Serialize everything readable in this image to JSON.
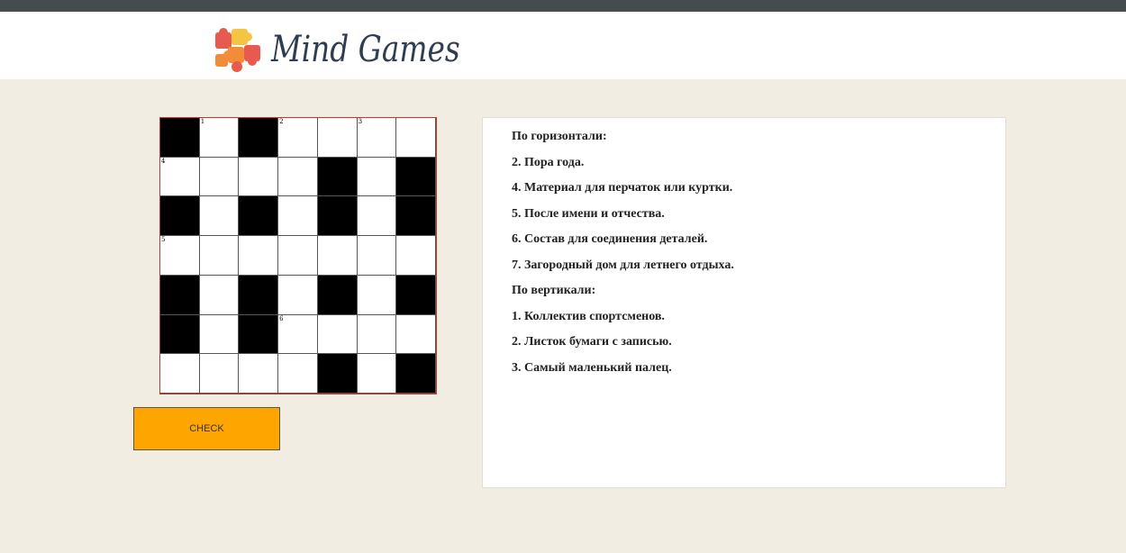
{
  "header": {
    "logo_text": "Mind Games"
  },
  "crossword": {
    "rows": [
      [
        {
          "b": 1
        },
        {
          "n": "1"
        },
        {
          "b": 1
        },
        {
          "n": "2"
        },
        {},
        {
          "n": "3"
        },
        {}
      ],
      [
        {
          "n": "4"
        },
        {},
        {},
        {},
        {
          "b": 1
        },
        {},
        {
          "b": 1
        }
      ],
      [
        {
          "b": 1
        },
        {},
        {
          "b": 1
        },
        {},
        {
          "b": 1
        },
        {},
        {
          "b": 1
        }
      ],
      [
        {
          "n": "5"
        },
        {},
        {},
        {},
        {},
        {},
        {}
      ],
      [
        {
          "b": 1
        },
        {},
        {
          "b": 1
        },
        {},
        {
          "b": 1
        },
        {},
        {
          "b": 1
        }
      ],
      [
        {
          "b": 1
        },
        {},
        {
          "b": 1
        },
        {
          "n": "6"
        },
        {},
        {},
        {}
      ],
      [
        {},
        {},
        {},
        {},
        {
          "b": 1
        },
        {},
        {
          "b": 1
        }
      ]
    ]
  },
  "check_button": {
    "label": "CHECK"
  },
  "clues": {
    "lines": [
      "По горизонтали:",
      "2. Пора года.",
      "4. Материал для перчаток или куртки.",
      "5. После имени и отчества.",
      "6. Состав для соединения деталей.",
      "7. Загородный дом для летнего отдыха.",
      "По вертикали:",
      "1. Коллектив спортсменов.",
      "2. Листок бумаги с записью.",
      "3. Самый маленький палец."
    ]
  },
  "colors": {
    "accent_button": "#ffa500",
    "page_background": "#f2ede2",
    "top_bar": "#444c50"
  }
}
